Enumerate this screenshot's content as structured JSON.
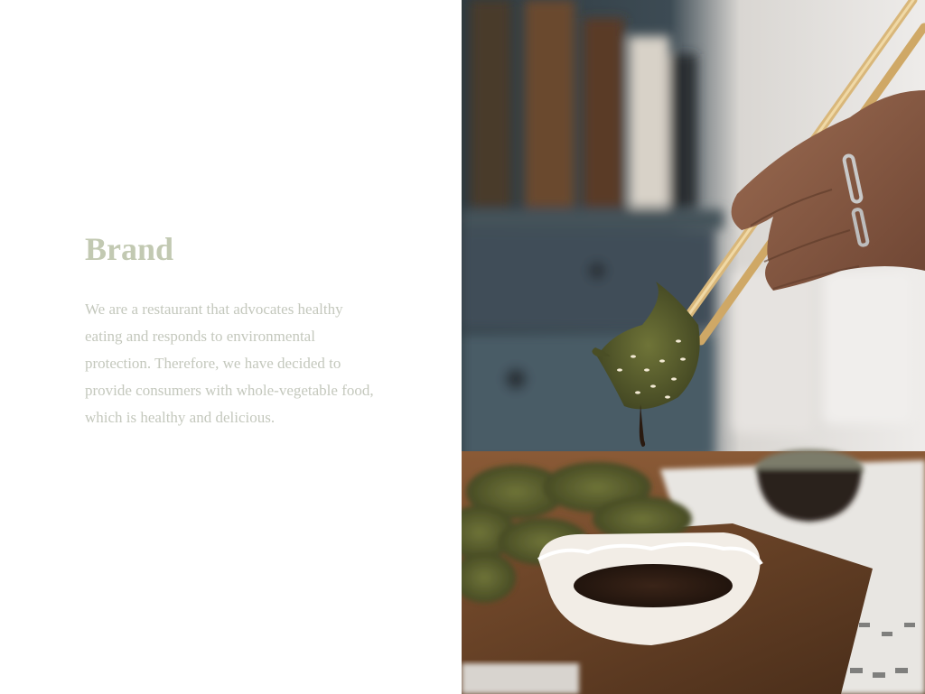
{
  "brand": {
    "title": "Brand",
    "description": "We are a restaurant that advocates healthy eating and responds to environmental protection. Therefore, we have decided to provide consumers with whole-vegetable food, which is healthy and delicious."
  },
  "colors": {
    "title": "#c2c9b2",
    "body_text": "#c4c8bd",
    "background": "#ffffff"
  },
  "photo": {
    "subject": "chopsticks-holding-dumpling-with-soy-sauce-bowl"
  }
}
